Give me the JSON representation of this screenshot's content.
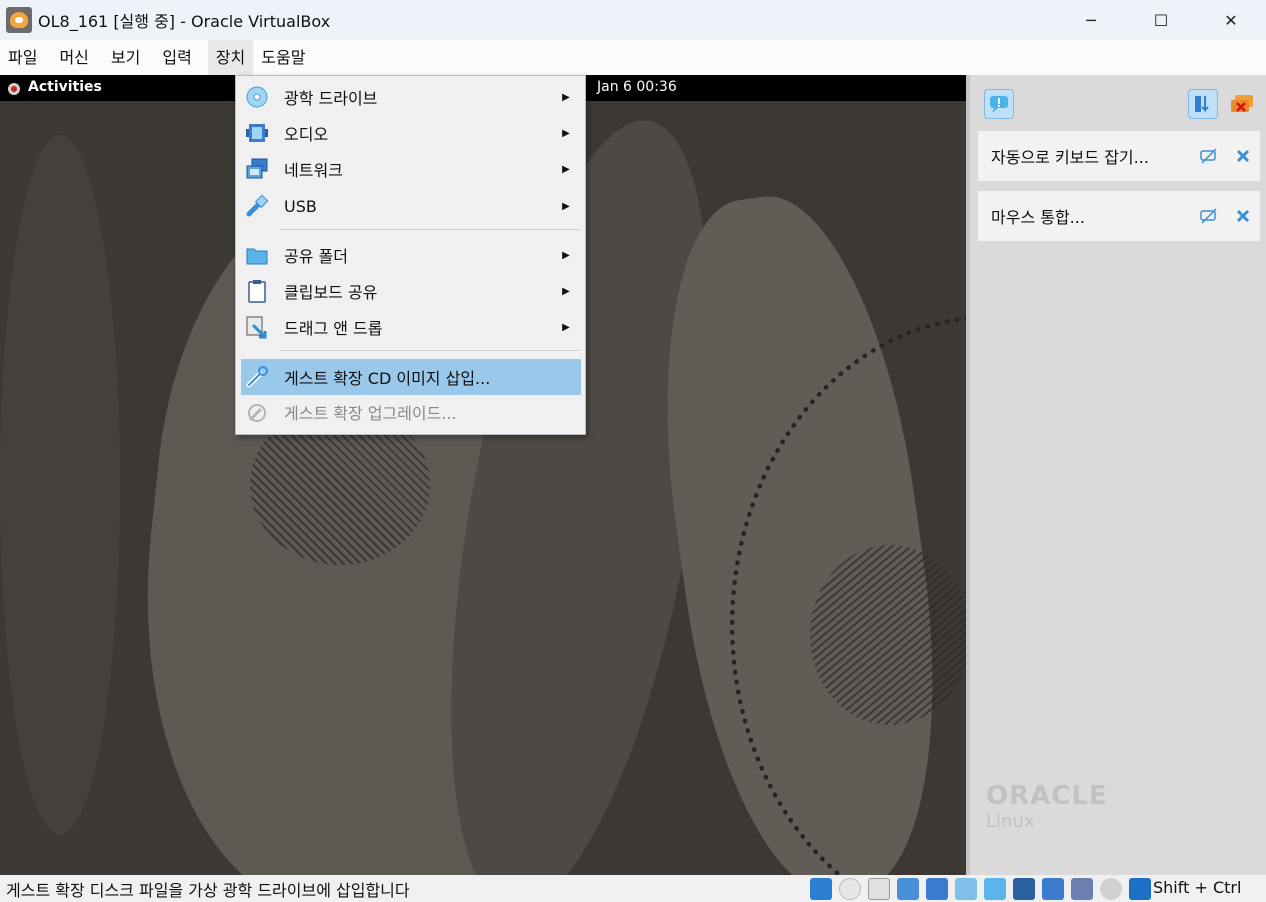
{
  "window": {
    "title": "OL8_161 [실행 중] - Oracle VirtualBox",
    "minimize": "─",
    "maximize": "☐",
    "close": "✕"
  },
  "menubar": {
    "items": [
      "파일",
      "머신",
      "보기",
      "입력",
      "장치",
      "도움말"
    ],
    "active": "장치"
  },
  "vm": {
    "activities": "Activities",
    "clock": "Jan 6  00:36",
    "brand_name": "ORACLE",
    "brand_product": "Linux"
  },
  "notifications": {
    "cards": [
      {
        "text": "자동으로 키보드 잡기..."
      },
      {
        "text": "마우스 통합..."
      }
    ]
  },
  "devices_menu": {
    "items": [
      {
        "label": "광학 드라이브",
        "icon": "optical-disc-icon",
        "submenu": true
      },
      {
        "label": "오디오",
        "icon": "audio-icon",
        "submenu": true
      },
      {
        "label": "네트워크",
        "icon": "network-icon",
        "submenu": true
      },
      {
        "label": "USB",
        "icon": "usb-icon",
        "submenu": true
      },
      {
        "label": "공유 폴더",
        "icon": "shared-folder-icon",
        "submenu": true
      },
      {
        "label": "클립보드 공유",
        "icon": "clipboard-icon",
        "submenu": true
      },
      {
        "label": "드래그 앤 드롭",
        "icon": "drag-drop-icon",
        "submenu": true
      },
      {
        "label": "게스트 확장 CD 이미지 삽입...",
        "icon": "guest-additions-icon",
        "submenu": false,
        "highlighted": true
      },
      {
        "label": "게스트 확장 업그레이드...",
        "icon": "guest-upgrade-icon",
        "submenu": false,
        "disabled": true
      }
    ]
  },
  "statusbar": {
    "text": "게스트 확장 디스크 파일을 가상 광학 드라이브에 삽입합니다",
    "host_key": "Shift + Ctrl"
  },
  "colors": {
    "highlight": "#9ac8ea",
    "accent": "#3a8fd6"
  }
}
